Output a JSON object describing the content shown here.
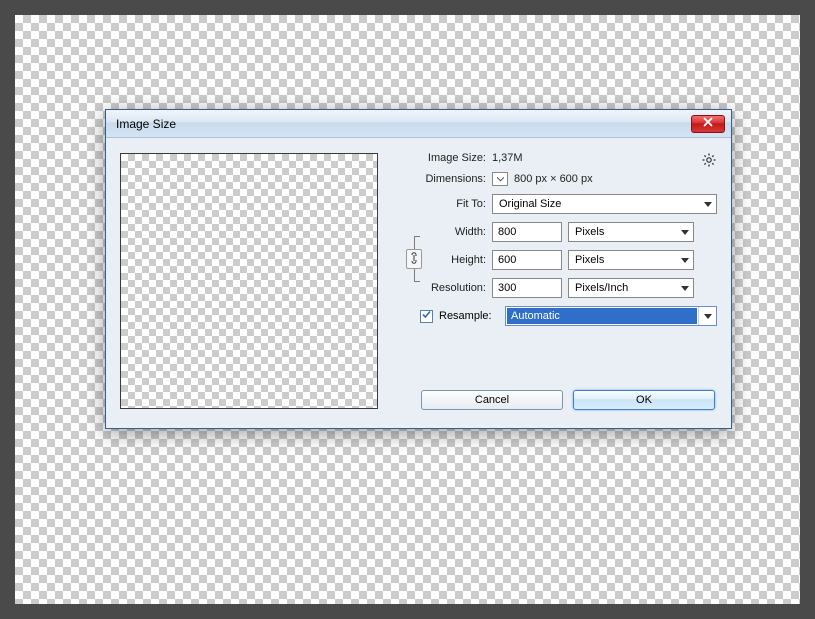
{
  "dialog": {
    "title": "Image Size",
    "image_size_label": "Image Size:",
    "image_size_value": "1,37M",
    "dimensions_label": "Dimensions:",
    "dimensions_value": "800 px  ×  600 px",
    "fit_to_label": "Fit To:",
    "fit_to_value": "Original Size",
    "width_label": "Width:",
    "width_value": "800",
    "width_unit": "Pixels",
    "height_label": "Height:",
    "height_value": "600",
    "height_unit": "Pixels",
    "resolution_label": "Resolution:",
    "resolution_value": "300",
    "resolution_unit": "Pixels/Inch",
    "resample_label": "Resample:",
    "resample_value": "Automatic",
    "cancel_label": "Cancel",
    "ok_label": "OK"
  }
}
